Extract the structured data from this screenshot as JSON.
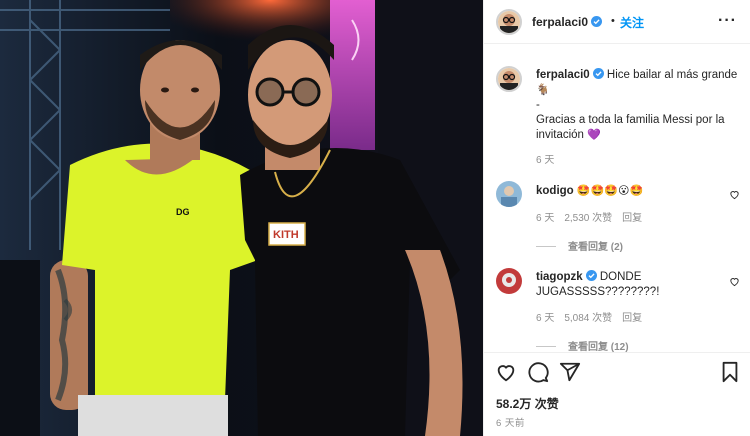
{
  "header": {
    "username": "ferpalaci0",
    "follow_label": "关注",
    "separator": "•",
    "more_label": "···"
  },
  "caption": {
    "username": "ferpalaci0",
    "line1": "Hice bailar al más grande",
    "line1_emoji": "🐐",
    "line2": "-",
    "line3": "Gracias a toda la familia Messi por la invitación",
    "line3_emoji": "💜",
    "time": "6 天"
  },
  "comments": [
    {
      "username": "kodigo",
      "text": "🤩🤩🤩😮🤩",
      "time": "6 天",
      "likes": "2,530 次赞",
      "reply": "回复",
      "view_replies": "查看回复 (2)"
    },
    {
      "username": "tiagopzk",
      "text": "DONDE JUGASSSSS????????!",
      "time": "6 天",
      "likes": "5,084 次赞",
      "reply": "回复",
      "view_replies": "查看回复 (12)"
    }
  ],
  "actions": {
    "icons": [
      "heart-icon",
      "comment-icon",
      "share-icon",
      "bookmark-icon"
    ],
    "likes_count": "58.2万 次赞",
    "posted_time": "6 天前"
  },
  "photo": {
    "tshirt_text_left": "DG",
    "tshirt_text_right": "KITH"
  },
  "colors": {
    "accent": "#0095f6",
    "verified": "#3897f0",
    "secondary_text": "#8e8e8e",
    "neon_shirt": "#dcf32a",
    "stage_pink": "#d84ec6"
  }
}
